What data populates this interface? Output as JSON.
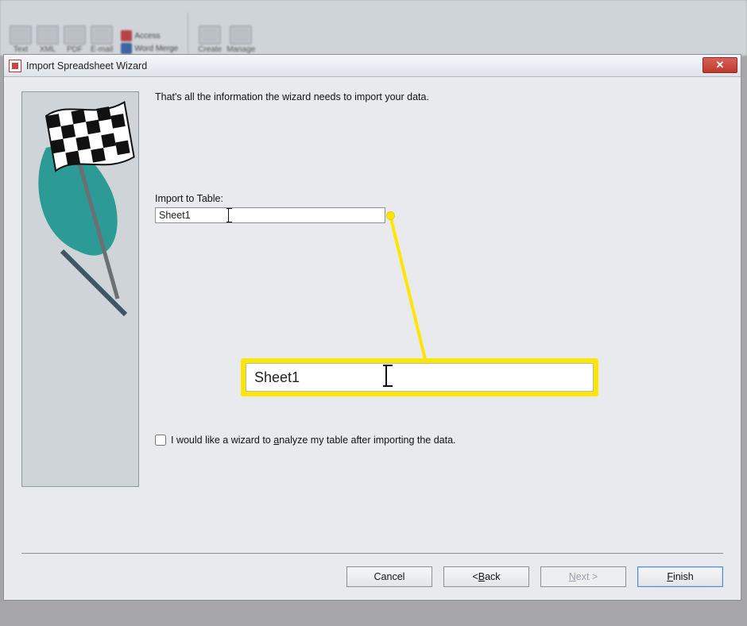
{
  "ribbon": {
    "items": [
      "Text",
      "XML",
      "PDF",
      "E-mail"
    ],
    "mini": [
      {
        "icon": "access-icon",
        "label": "Access"
      },
      {
        "icon": "wordmerge-icon",
        "label": "Word Merge"
      }
    ],
    "right": [
      "Create",
      "Manage"
    ]
  },
  "dlg": {
    "title": "Import Spreadsheet Wizard",
    "close": "✕",
    "instr": "That's all the information the wizard needs to import your data.",
    "field_label": "Import to Table:",
    "field_value": "Sheet1",
    "callout_value": "Sheet1",
    "checkbox_label_pre": "I would like a wizard to ",
    "checkbox_label_u": "a",
    "checkbox_label_post": "nalyze my table after importing the data.",
    "btn_cancel": "Cancel",
    "btn_back_u": "B",
    "btn_back_rest": "ack",
    "btn_back_prefix": "< ",
    "btn_next_u": "N",
    "btn_next_rest": "ext >",
    "btn_finish_u": "F",
    "btn_finish_rest": "inish"
  }
}
